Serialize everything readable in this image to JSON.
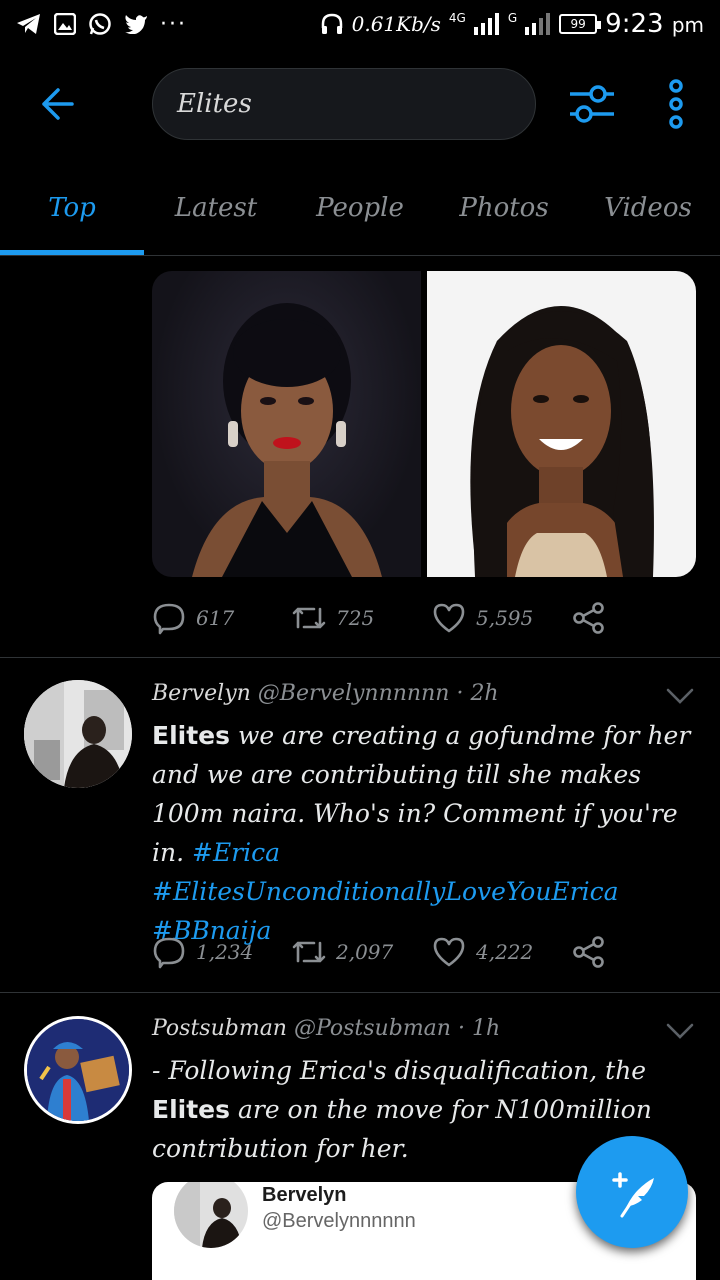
{
  "status_bar": {
    "speed": "0.61Kb/s",
    "network_1": "4G",
    "network_2": "G",
    "battery": "99",
    "time": "9:23",
    "ampm": "pm",
    "icons": [
      "telegram-icon",
      "gallery-icon",
      "whatsapp-icon",
      "twitter-icon",
      "more-notifications-icon",
      "headphones-icon"
    ]
  },
  "search": {
    "query": "Elites"
  },
  "tabs": [
    {
      "label": "Top",
      "active": true
    },
    {
      "label": "Latest",
      "active": false
    },
    {
      "label": "People",
      "active": false
    },
    {
      "label": "Photos",
      "active": false
    },
    {
      "label": "Videos",
      "active": false
    }
  ],
  "tweet_0": {
    "replies": "617",
    "retweets": "725",
    "likes": "5,595"
  },
  "tweet_1": {
    "name": "Bervelyn",
    "handle": "@Bervelynnnnnn",
    "time": "2h",
    "keyword": "Elites",
    "text_1": " we are creating a gofundme for her and we are contributing till she makes 100m naira. Who's in? Comment if you're in. ",
    "hashtags": [
      "#Erica",
      "#ElitesUnconditionallyLoveYouErica",
      "#BBnaija"
    ],
    "replies": "1,234",
    "retweets": "2,097",
    "likes": "4,222"
  },
  "tweet_2": {
    "name": "Postsubman",
    "handle": "@Postsubman",
    "time": "1h",
    "text_1": "- Following Erica's disqualification, the ",
    "keyword": "Elites",
    "text_2": " are on the move for N100million contribution for her.",
    "quote": {
      "name": "Bervelyn",
      "handle": "@Bervelynnnnnn"
    }
  },
  "colors": {
    "accent": "#1d9bf0",
    "background": "#000000",
    "muted": "#8b8f93",
    "divider": "#2f3336"
  }
}
